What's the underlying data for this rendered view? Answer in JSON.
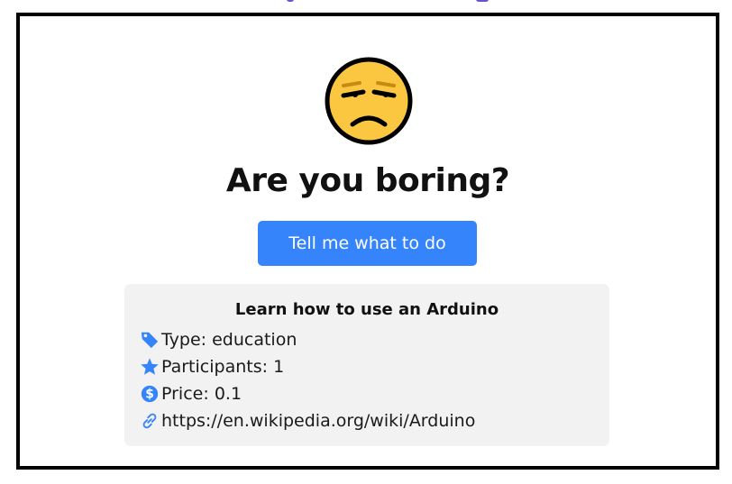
{
  "app": {
    "accent_color": "#3584fb",
    "card_bg_color": "#f2f2f2",
    "emoji_icon": "unamused-face-icon"
  },
  "header": {
    "title": "Are you boring?"
  },
  "actions": {
    "suggest_label": "Tell me what to do"
  },
  "activity": {
    "title": "Learn how to use an Arduino",
    "fields": [
      {
        "icon": "tag-icon",
        "label": "Type:",
        "value": "education"
      },
      {
        "icon": "star-icon",
        "label": "Participants:",
        "value": "1"
      },
      {
        "icon": "dollar-icon",
        "label": "Price:",
        "value": "0.1"
      },
      {
        "icon": "link-icon",
        "label": "",
        "value": "https://en.wikipedia.org/wiki/Arduino"
      }
    ]
  }
}
